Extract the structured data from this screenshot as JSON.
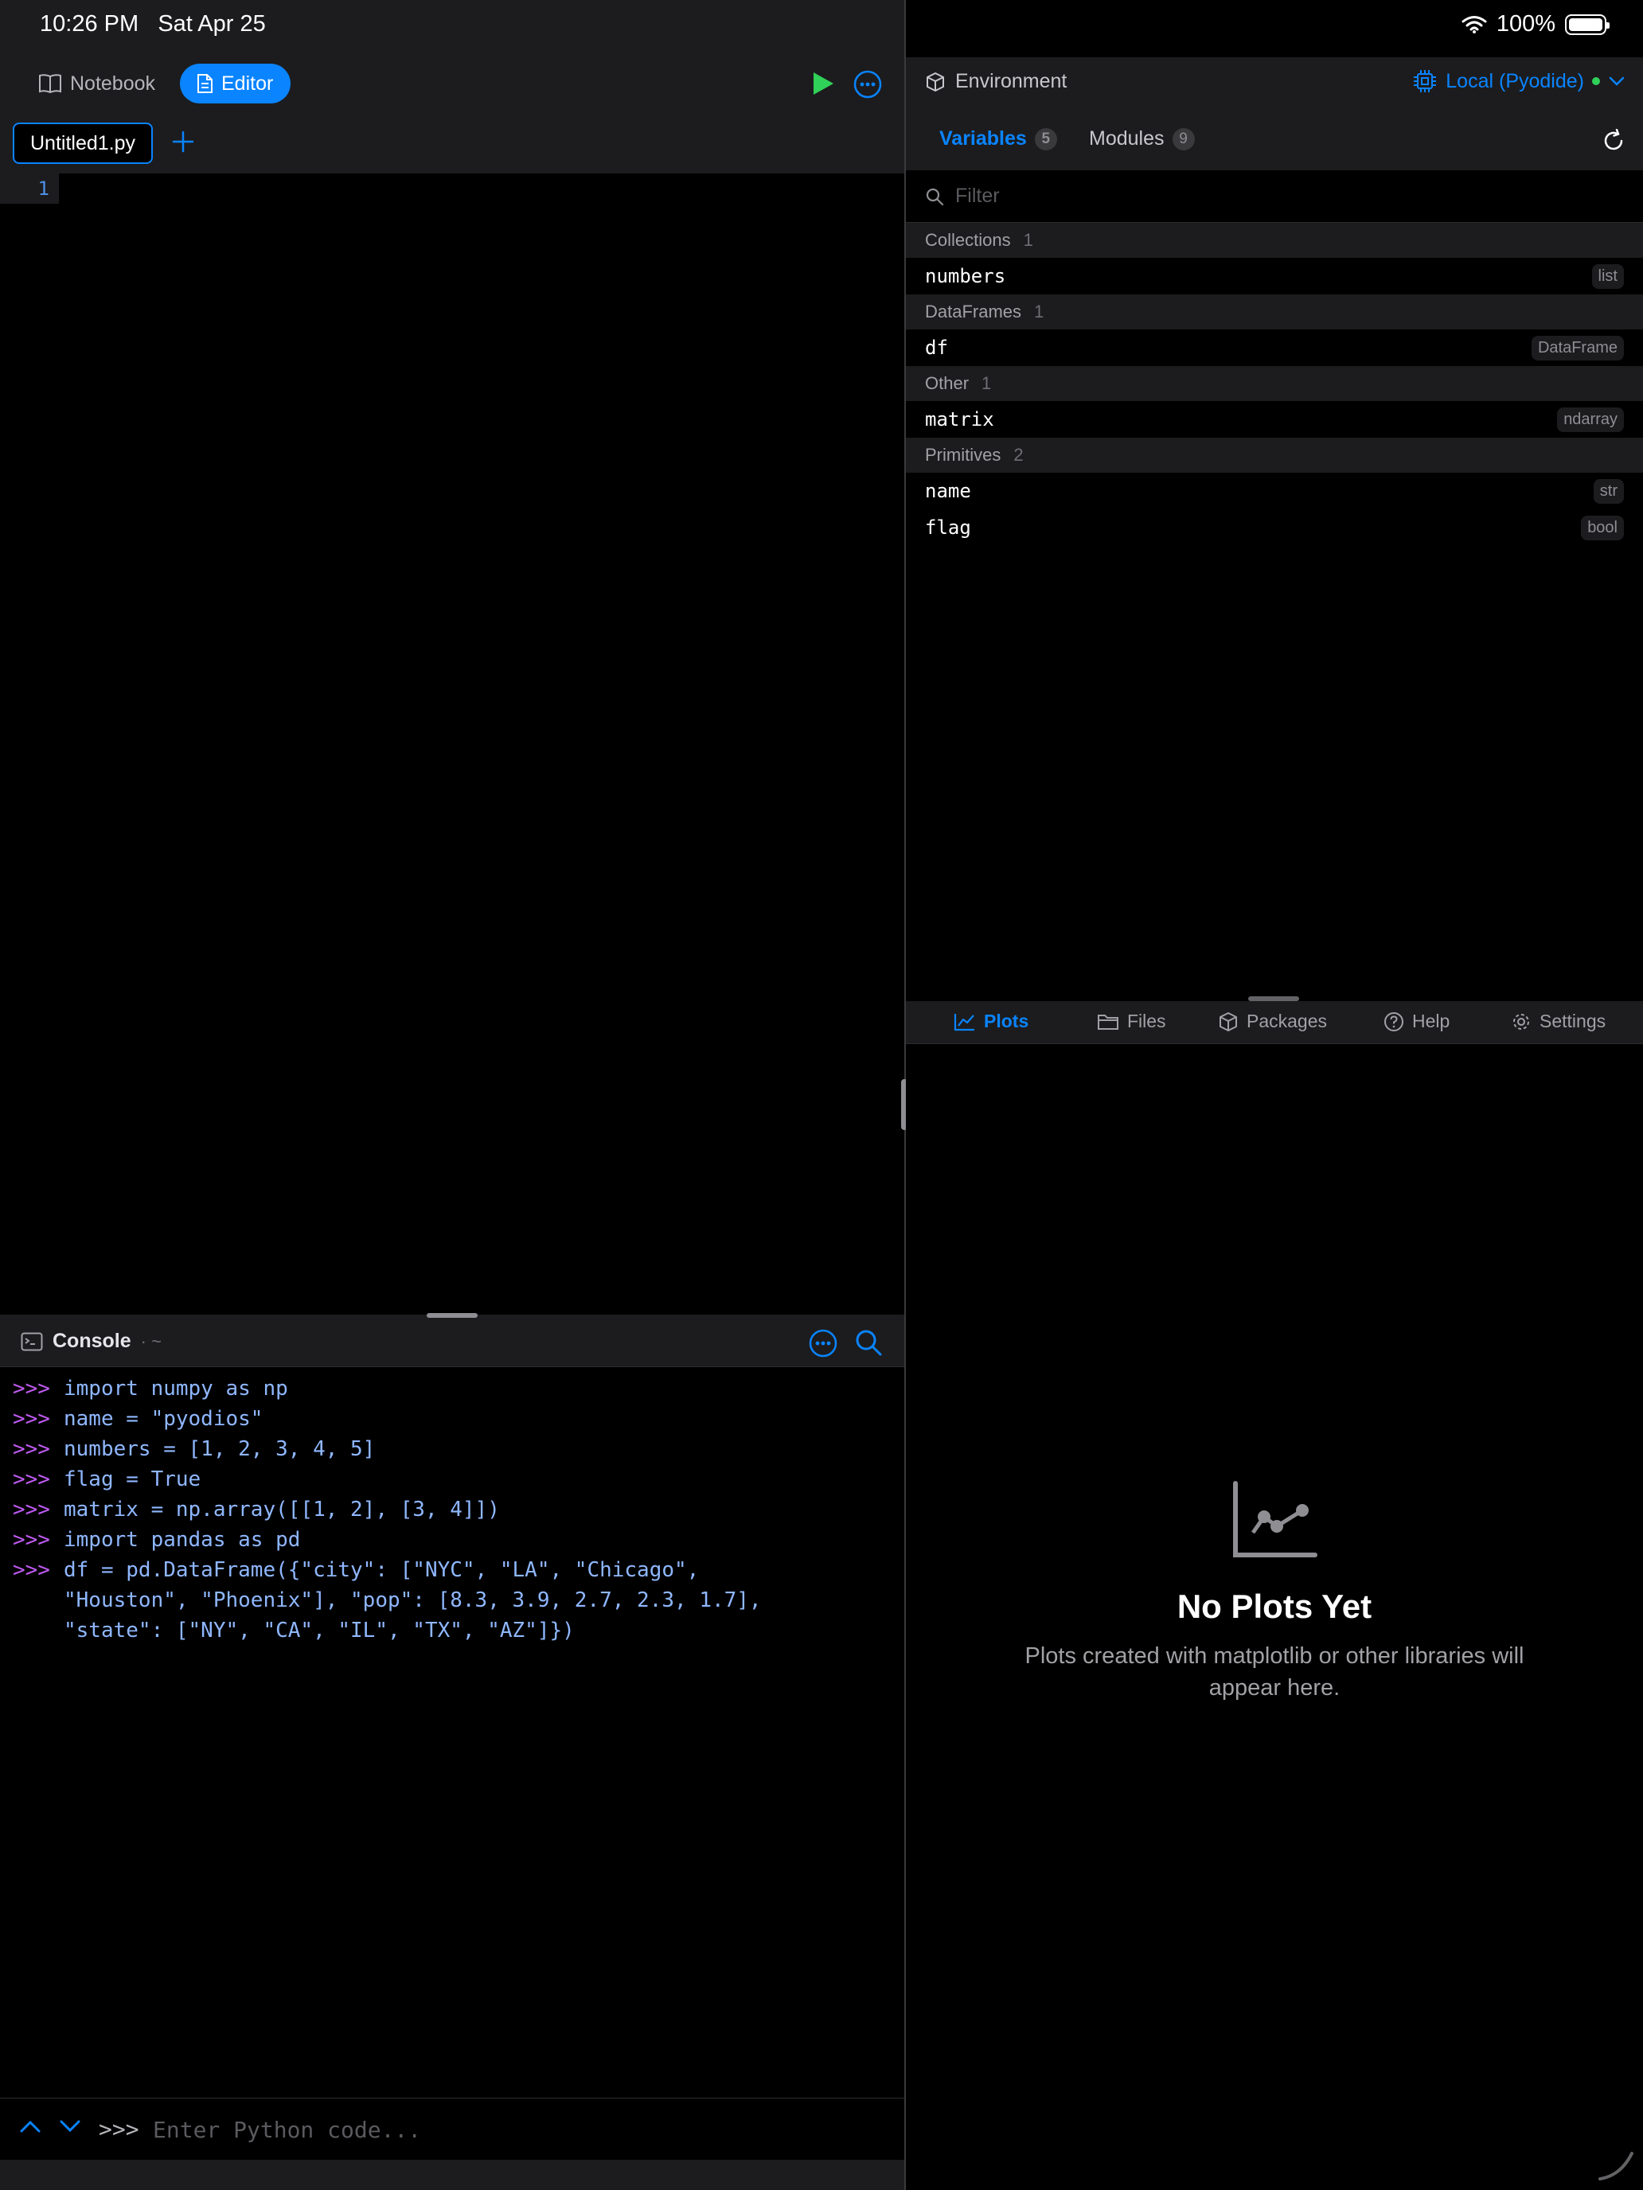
{
  "status_bar": {
    "time": "10:26 PM",
    "date": "Sat Apr 25",
    "battery": "100%",
    "battery_level": 1.0,
    "icons": [
      "wifi-icon",
      "battery-icon"
    ]
  },
  "mode_switcher": {
    "notebook_label": "Notebook",
    "editor_label": "Editor",
    "active": "Editor",
    "icons": [
      "book-icon",
      "document-icon",
      "play-icon",
      "more-icon"
    ]
  },
  "editor": {
    "tab_label": "Untitled1.py",
    "line_numbers": [
      "1"
    ]
  },
  "console": {
    "title": "Console",
    "subtitle": "· ~",
    "prompt": ">>>",
    "lines": [
      "import numpy as np",
      "name = \"pyodios\"",
      "numbers = [1, 2, 3, 4, 5]",
      "flag = True",
      "matrix = np.array([[1, 2], [3, 4]])",
      "import pandas as pd",
      "df = pd.DataFrame({\"city\": [\"NYC\", \"LA\", \"Chicago\",\n\"Houston\", \"Phoenix\"], \"pop\": [8.3, 3.9, 2.7, 2.3, 1.7],\n\"state\": [\"NY\", \"CA\", \"IL\", \"TX\", \"AZ\"]})"
    ],
    "input_placeholder": "Enter Python code...",
    "input_value": ""
  },
  "environment": {
    "title": "Environment",
    "runtime_label": "Local (Pyodide)",
    "runtime_status_color": "#30d158",
    "tabs": [
      {
        "label": "Variables",
        "count": "5"
      },
      {
        "label": "Modules",
        "count": "9"
      }
    ],
    "filter_placeholder": "Filter",
    "filter_value": "",
    "groups": [
      {
        "name": "Collections",
        "count": "1",
        "items": [
          {
            "name": "numbers",
            "type": "list"
          }
        ]
      },
      {
        "name": "DataFrames",
        "count": "1",
        "items": [
          {
            "name": "df",
            "type": "DataFrame"
          }
        ]
      },
      {
        "name": "Other",
        "count": "1",
        "items": [
          {
            "name": "matrix",
            "type": "ndarray"
          }
        ]
      },
      {
        "name": "Primitives",
        "count": "2",
        "items": [
          {
            "name": "name",
            "type": "str"
          },
          {
            "name": "flag",
            "type": "bool"
          }
        ]
      }
    ]
  },
  "tools": {
    "tabs": [
      "Plots",
      "Files",
      "Packages",
      "Help",
      "Settings"
    ],
    "active": "Plots",
    "empty_title": "No Plots Yet",
    "empty_desc": "Plots created with matplotlib or other libraries will appear here."
  },
  "colors": {
    "accent": "#0a84ff",
    "run": "#30d158",
    "prompt": "#bf5af2",
    "code": "#8fb7ff",
    "panel": "#1c1c1e"
  }
}
